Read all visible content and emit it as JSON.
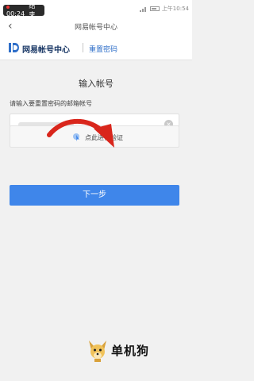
{
  "status_bar": {
    "recording_time": "00:24",
    "recording_end": "结束",
    "clock": "上午10:54"
  },
  "nav": {
    "title": "网易帐号中心"
  },
  "brand": {
    "name": "网易帐号中心",
    "subtitle": "重置密码"
  },
  "page": {
    "heading": "输入帐号",
    "prompt": "请输入要重置密码的邮箱帐号"
  },
  "verify": {
    "label": "点此进行验证"
  },
  "next_button": {
    "label": "下一步"
  },
  "watermark": {
    "text": "单机狗"
  },
  "colors": {
    "accent": "#3f86ea",
    "brand_dark": "#1a3866",
    "arrow": "#d9261c"
  }
}
